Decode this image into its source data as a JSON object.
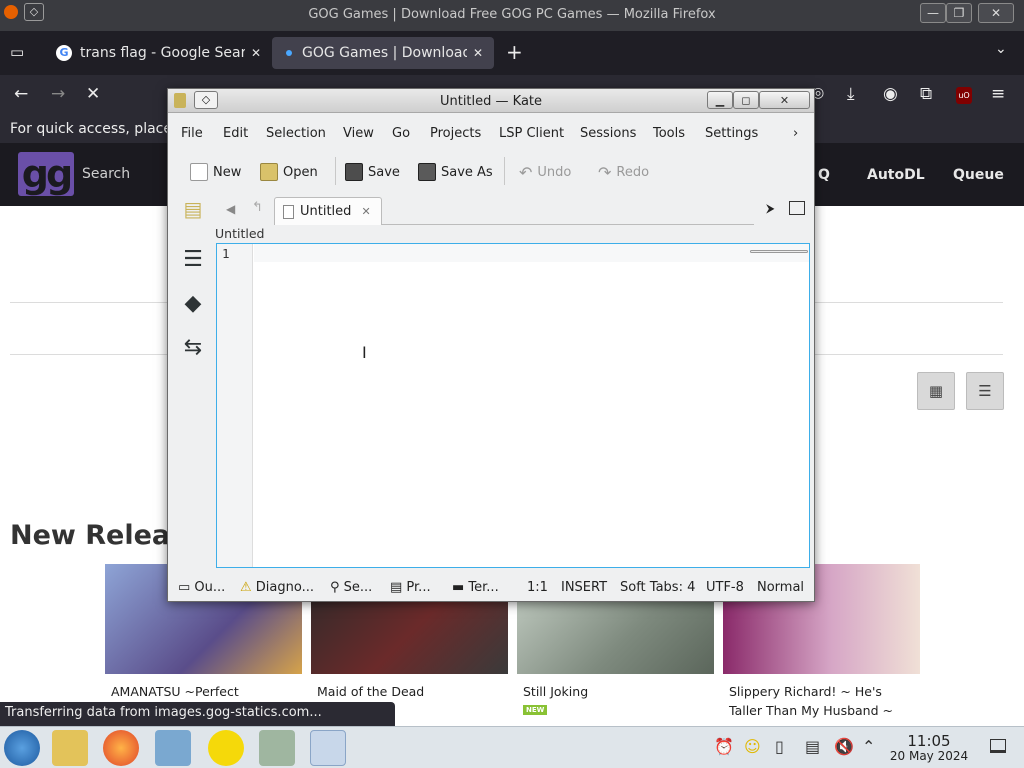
{
  "firefox": {
    "window_title": "GOG Games | Download Free GOG PC Games — Mozilla Firefox",
    "tabs": [
      {
        "label": "trans flag - Google Searc",
        "active": false
      },
      {
        "label": "GOG Games | Download",
        "active": true
      }
    ],
    "bookmarks_text": "For quick access, place",
    "status_text": "Transferring data from images.gog-statics.com...",
    "icons": [
      "back-arrow-icon",
      "forward-arrow-icon",
      "stop-icon",
      "download-icon",
      "account-icon",
      "extensions-icon",
      "ublock-icon",
      "menu-icon"
    ]
  },
  "site": {
    "search_placeholder": "Search",
    "nav": [
      "Q",
      "AutoDL",
      "Queue"
    ],
    "section_title": "New Releases",
    "new_badge": "NEW",
    "games": [
      {
        "title": "AMANATSU ~Perfect Edition~",
        "thumb_color": "#6f7fb0"
      },
      {
        "title": "Maid of the Dead",
        "thumb_color": "#3a3a3a"
      },
      {
        "title": "Still Joking",
        "thumb_color": "#9aa59a",
        "is_new": true
      },
      {
        "title": "Slippery Richard! ~ He's Taller Than My Husband ~",
        "thumb_color": "#c9a7c0"
      }
    ]
  },
  "kate": {
    "window_title": "Untitled — Kate",
    "menu": [
      "File",
      "Edit",
      "Selection",
      "View",
      "Go",
      "Projects",
      "LSP Client",
      "Sessions",
      "Tools",
      "Settings"
    ],
    "toolbar": {
      "new": "New",
      "open": "Open",
      "save": "Save",
      "save_as": "Save As",
      "undo": "Undo",
      "redo": "Redo"
    },
    "tab_label": "Untitled",
    "breadcrumb": "Untitled",
    "line_number": "1",
    "statusbar": {
      "output": "Ou...",
      "diagnostics": "Diagno...",
      "search": "Se...",
      "projects": "Pr...",
      "terminal": "Ter...",
      "position": "1:1",
      "mode": "INSERT",
      "indent": "Soft Tabs: 4",
      "encoding": "UTF-8",
      "highlight": "Normal"
    }
  },
  "taskbar": {
    "time": "11:05",
    "date": "20 May 2024"
  }
}
